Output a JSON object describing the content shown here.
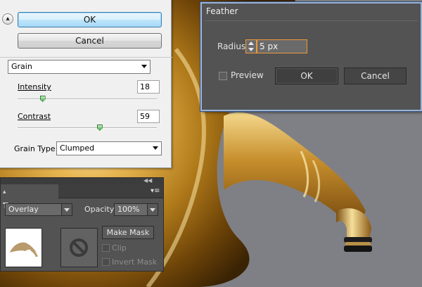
{
  "grain_dialog": {
    "ok_label": "OK",
    "cancel_label": "Cancel",
    "filter_select": "Grain",
    "intensity_label": "Intensity",
    "intensity_value": "18",
    "intensity_fraction": 0.18,
    "contrast_label": "Contrast",
    "contrast_value": "59",
    "contrast_fraction": 0.59,
    "grain_type_label": "Grain Type:",
    "grain_type_value": "Clumped"
  },
  "feather_dialog": {
    "title": "Feather",
    "radius_label": "Radius:",
    "radius_value": "5 px",
    "preview_label": "Preview",
    "preview_checked": false,
    "ok_label": "OK",
    "cancel_label": "Cancel"
  },
  "transparency_panel": {
    "tab_label": "Transparency",
    "blend_mode": "Overlay",
    "opacity_label": "Opacity:",
    "opacity_value": "100%",
    "make_mask_label": "Make Mask",
    "clip_label": "Clip",
    "invert_mask_label": "Invert Mask"
  },
  "icons": [
    "collapse-arrows-icon",
    "spin-arrows-icon",
    "panel-collapse-icon",
    "panel-menu-icon",
    "no-mask-icon"
  ],
  "colors": {
    "feather_accent": "#ec9a3a",
    "panel_bg": "#535353",
    "dialog_bg": "#f0f0f0",
    "canvas_bg": "#7e7f84"
  }
}
